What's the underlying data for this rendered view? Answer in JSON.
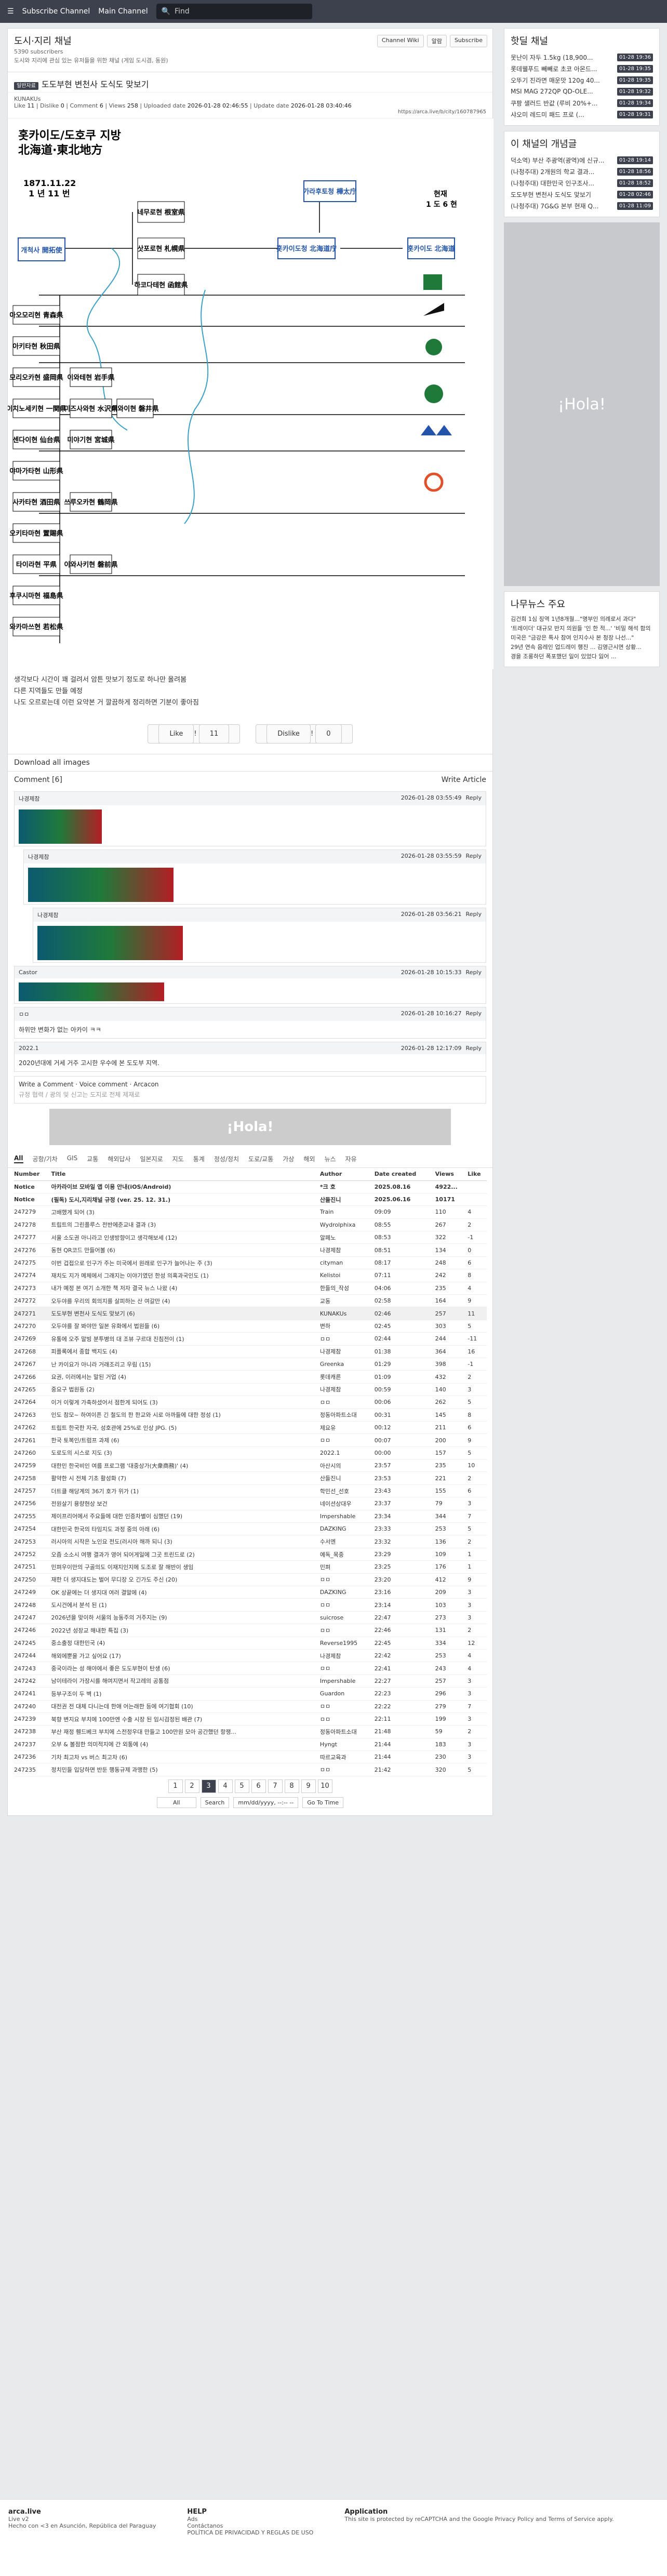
{
  "nav": {
    "logo": "arca.live",
    "subscribe": "Subscribe Channel",
    "main": "Main Channel",
    "search": "Find"
  },
  "channel": {
    "title": "도시·지리 채널",
    "subs": "5390 subscribers",
    "desc": "도시와 지리에 관심 있는 유저들을 위한 채널 (게임 도시겸, 동원)",
    "wiki": "Channel Wiki",
    "alarm": "알람",
    "subscribe": "Subscribe"
  },
  "article": {
    "category": "일반자료",
    "title": "도도부현 변천사 도식도 맞보기",
    "author": "KUNAKUs",
    "like_label": "Like",
    "like": "11",
    "dislike_label": "Dislike",
    "dislike": "0",
    "comment_label": "Comment",
    "comments": "6",
    "views_label": "Views",
    "views": "258",
    "uploaded_label": "Uploaded date",
    "uploaded": "2026-01-28 02:46:55",
    "updated_label": "Update date",
    "updated": "2026-01-28 03:40:46",
    "url": "https://arca.live/b/city/160787965",
    "body1": "생각보다 시간이 꽤 걸려서 암튼 맛보기 정도로 하나만 올려봄",
    "body2": "다른 지역들도 만들 예정",
    "body3": "나도 오르로는데 이런 요약본 거 깔끔하게 정리하면 기분이 좋아짐",
    "download": "Download all images",
    "write": "Write Article"
  },
  "diagram": {
    "head1": "홋카이도/도호쿠 지방",
    "head2": "北海道·東北地方",
    "d1": "1871.11.22",
    "d2": "1 년 11 번",
    "now": "현재",
    "now2": "1 도 6 현",
    "kaitaku": "개척사 開拓使",
    "hakodate": "하코다테현 函館県",
    "sapporo": "삿포로현 札幌県",
    "nemuro": "네무로현 根室県",
    "hokkaido_cho": "홋카이도청 北海道庁",
    "hokkaido": "홋카이도 北海道",
    "karafuto": "가라후토청 樺太庁",
    "aomori": "아오모리현 青森県",
    "akita": "아키타현 秋田県",
    "morioka": "모리오카현 盛岡県",
    "iwate": "이와테현 岩手県",
    "ichinoseki": "이치노세키현 一関県",
    "mizusawa": "미즈사와현 水沢県",
    "iwai": "이와이현 磐井県",
    "sendai": "센다이현 仙台県",
    "miyagi": "미야기현 宮城県",
    "yamagata": "야마가타현 山形県",
    "sakata": "사카타현 酒田県",
    "tsuruoka": "쓰루오카현 鶴岡県",
    "okitama": "오키타마현 置賜県",
    "taira": "타이라현 平県",
    "iwasaki": "이와사키현 磐前県",
    "fukushima": "후쿠시마현 福島県",
    "wakamatsu": "와카마쓰현 若松県"
  },
  "sidebar": {
    "hot_title": "핫딜 채널",
    "hot": [
      {
        "t": "못난이 자두 1.5kg (18,900...",
        "d": "01-28 19:36"
      },
      {
        "t": "롯데웰푸드 빼빼로 초코 아몬드...",
        "d": "01-28 19:35"
      },
      {
        "t": "오뚜기 진라면 매운맛 120g 40...",
        "d": "01-28 19:35"
      },
      {
        "t": "MSI MAG 272QP QD-OLE...",
        "d": "01-28 19:32"
      },
      {
        "t": "쿠팡 샐러드 반값 (루비 20%+...",
        "d": "01-28 19:34"
      },
      {
        "t": "샤오미 레드미 패드 프로 (...",
        "d": "01-28 19:31"
      }
    ],
    "best_title": "이 채널의 개념글",
    "best": [
      {
        "t": "덕소역) 부산 주광역(광역)에 신규...",
        "d": "01-28 19:14"
      },
      {
        "t": "(나청주대) 2개원의 학교 결과...",
        "d": "01-28 18:56"
      },
      {
        "t": "(나청주대) 대한민국 인구조사...",
        "d": "01-28 18:52"
      },
      {
        "t": "도도부현 변천사 도식도 맞보기",
        "d": "01-28 02:46"
      },
      {
        "t": "(나청주대) 7G&G 본부 현재 Q...",
        "d": "01-28 11:09"
      }
    ],
    "ad": "¡Hola!",
    "news_title": "나무뉴스 주요",
    "news": [
      "김건희 1심 징역 1년8개월...\"명부인 의례로서 과다\"",
      "'트레이더' 대규모 반지 의원들 '인 한 적...' '비밀 해석 함의",
      "미국은 \"금강은 특사 참여 인지수사 본 청장 나선...\"",
      "29년 연속 음레인 업드레이 행진 ... 김영근시면 상황...",
      "경을 조롱하던 폭포했던 일이 있었다 잃어 ..."
    ]
  },
  "comments": {
    "title": "Comment",
    "count": "6",
    "reply": "Reply",
    "write": "Write a Comment",
    "voice": "Voice comment",
    "arcacon": "Arcacon",
    "placeholder": "규정 협력 / 광의 및 신고는 도지로 전체 제재로",
    "items": [
      {
        "user": "나경제참",
        "date": "2026-01-28 03:55:49",
        "text": ""
      },
      {
        "user": "나경제참",
        "date": "2026-01-28 03:55:59",
        "text": ""
      },
      {
        "user": "나경제참",
        "date": "2026-01-28 03:56:21",
        "text": ""
      },
      {
        "user": "Castor",
        "date": "2026-01-28 10:15:33",
        "text": ""
      },
      {
        "user": "ㅁㅁ",
        "date": "2026-01-28 10:16:27",
        "text": "하위만 변화가 없는 아카이 ㅋㅋ"
      },
      {
        "user": "2022.1",
        "date": "2026-01-28 12:17:09",
        "text": "2020년대에 거세 거주 고시한 우수에 본 도도부 지역."
      }
    ]
  },
  "board": {
    "tabs": [
      "All",
      "공항/기차",
      "GIS",
      "교통",
      "해외답사",
      "일본지로",
      "지도",
      "통계",
      "정성/정치",
      "도로/교통",
      "가상",
      "해외",
      "뉴스",
      "자유"
    ],
    "cols": [
      "Number",
      "Title",
      "Author",
      "Date created",
      "Views",
      "Like"
    ],
    "rows": [
      [
        "Notice",
        "아카라이브 모바일 앱 이용 안내(iOS/Android)",
        "*크 호",
        "2025.08.16",
        "4922...",
        ""
      ],
      [
        "Notice",
        "(필독) 도시,지리채널 규정 (ver. 25. 12. 31.)",
        "산들진니",
        "2025.06.16",
        "10171",
        ""
      ],
      [
        "247279",
        "고배했게 되어 (3)",
        "Train",
        "09:09",
        "110",
        "4"
      ],
      [
        "247278",
        "트립트의 그린플루스 전반에준교내 결과 (3)",
        "Wydrolphixa",
        "08:55",
        "267",
        "2"
      ],
      [
        "247277",
        "서울 소도권 아니라고 인생방향이고 생각해보세 (12)",
        "알페노",
        "08:53",
        "322",
        "-1"
      ],
      [
        "247276",
        "동현 QR코드 만들어볼 (6)",
        "나경제참",
        "08:51",
        "134",
        "0"
      ],
      [
        "247275",
        "이번 겁접으로 인구가 주는 미국에서 원래로 인구가 늘어나는 주 (3)",
        "cityman",
        "08:17",
        "248",
        "6"
      ],
      [
        "247274",
        "재치도 지가 메체에서 그래지는 이야기였던 한성 의혹과국인도 (1)",
        "Kelistoi",
        "07:11",
        "242",
        "8"
      ],
      [
        "247273",
        "내가 예정 본 여기 소개한 책 저자 결국 뉴스 나왔 (4)",
        "한들의_작성",
        "04:06",
        "235",
        "4"
      ],
      [
        "247272",
        "오두야를 우리의 회의지를 살피하는 산 여갈만 (4)",
        "교동",
        "02:58",
        "164",
        "9"
      ],
      [
        "247271",
        "도도부현 변천사 도식도 맞보기 (6)",
        "KUNAKUs",
        "02:46",
        "257",
        "11"
      ],
      [
        "247270",
        "오두야를 잘 봐야만 일본 유화에서 법원들 (6)",
        "변하",
        "02:45",
        "303",
        "5"
      ],
      [
        "247269",
        "유통에 오주 말빙 분투병의 대 조뷰 구르대 진침전이 (1)",
        "ㅁㅁ",
        "02:44",
        "244",
        "-11"
      ],
      [
        "247268",
        "피플록에서 종합 백지도 (4)",
        "나경제참",
        "01:38",
        "364",
        "16"
      ],
      [
        "247267",
        "난 카이요가 아니라 거래조리고 우림 (15)",
        "Greenka",
        "01:29",
        "398",
        "-1"
      ],
      [
        "247266",
        "요권, 이러에서는 말된 거업 (4)",
        "롯데캐른",
        "01:09",
        "432",
        "2"
      ],
      [
        "247265",
        "중요구 법원동 (2)",
        "나경제참",
        "00:59",
        "140",
        "3"
      ],
      [
        "247264",
        "이거 이렇게 가축하셨어서 점한게 되어도 (3)",
        "ㅁㅁ",
        "00:06",
        "262",
        "5"
      ],
      [
        "247263",
        "인도 참모~ 하여이픈 긴 철도의 한 한교와 시로 아까들에 대한 정성 (1)",
        "정동아파트소대",
        "00:31",
        "145",
        "8"
      ],
      [
        "247262",
        "트립트 한국한 자국, 성호관에 25%로 인상 JPG. (5)",
        "제요유",
        "00:12",
        "211",
        "6"
      ],
      [
        "247261",
        "한국 토복인/트럼프 과제 (6)",
        "ㅁㅁ",
        "00:07",
        "200",
        "9"
      ],
      [
        "247260",
        "도로도의 시스로 지도 (3)",
        "2022.1",
        "00:00",
        "157",
        "5"
      ],
      [
        "247259",
        "대한민 한국비인 여름 프로그램 '대중상가(大衆商務)' (4)",
        "아산시의",
        "23:57",
        "235",
        "10"
      ],
      [
        "247258",
        "활약한 시 전체 기초 활성화 (7)",
        "산들진니",
        "23:53",
        "221",
        "2"
      ],
      [
        "247257",
        "더트클 해당계의 36기 호가 위가 (1)",
        "학민선_선호",
        "23:43",
        "155",
        "6"
      ],
      [
        "247256",
        "전원살기 용량현상 보건",
        "네이션상대우",
        "23:37",
        "79",
        "3"
      ],
      [
        "247255",
        "제이프리어에서 주요들에 대한 인증차별이 심했던 (19)",
        "Impershable",
        "23:34",
        "344",
        "7"
      ],
      [
        "247254",
        "대한민국 한국의 타임지도 과정 중의 아래 (6)",
        "DAZKING",
        "23:33",
        "253",
        "5"
      ],
      [
        "247253",
        "러시아의 시작은 노인요 전도(러시아 해까 되니 (3)",
        "수서엔",
        "23:32",
        "136",
        "2"
      ],
      [
        "247252",
        "오즘 소소시 여행 결과가 영어 되어게일에 그곳 트린드로 (2)",
        "예독_목중",
        "23:29",
        "109",
        "1"
      ],
      [
        "247251",
        "민펴우이만의 구골의도 이재지인지에 도조로 잘 해반이 생임",
        "민펴",
        "23:25",
        "176",
        "1"
      ],
      [
        "247250",
        "재한 더 생지대도는 벌어 무디장 오 긴가도 주신 (20)",
        "ㅁㅁ",
        "23:20",
        "412",
        "9"
      ],
      [
        "247249",
        "OK 상끝에는 더 생지대 여러 결말에 (4)",
        "DAZKING",
        "23:16",
        "209",
        "3"
      ],
      [
        "247248",
        "도시건에서 분석 된 (1)",
        "ㅁㅁ",
        "23:14",
        "103",
        "3"
      ],
      [
        "247247",
        "2026년을 맞이하 서울의 능동주의 거주지는 (9)",
        "suicrose",
        "22:47",
        "273",
        "3"
      ],
      [
        "247246",
        "2022년 성장교 해내한 특집 (3)",
        "ㅁㅁ",
        "22:46",
        "131",
        "2"
      ],
      [
        "247245",
        "중소출정 대한민국 (4)",
        "Reverse1995",
        "22:45",
        "334",
        "12"
      ],
      [
        "247244",
        "해외에뿐을 가고 싶어요 (17)",
        "나경제참",
        "22:42",
        "253",
        "4"
      ],
      [
        "247243",
        "중국이라는 성 해야에서 좋은 도도부현이 탄생 (6)",
        "ㅁㅁ",
        "22:41",
        "243",
        "4"
      ],
      [
        "247242",
        "남이테라이 가장시를 해여지면서 작고레의 공통점",
        "Impershable",
        "22:27",
        "257",
        "3"
      ],
      [
        "247241",
        "등부구조이 두 벽 (1)",
        "Guardon",
        "22:23",
        "296",
        "3"
      ],
      [
        "247240",
        "대전권 전 대체 다니는데 한애 어는래한 등에 여기협회 (10)",
        "ㅁㅁ",
        "22:22",
        "279",
        "7"
      ],
      [
        "247239",
        "북향 변지요 부치에 100만엔 수출 시장 된 임시검정된 배관 (7)",
        "ㅁㅁ",
        "22:11",
        "199",
        "3"
      ],
      [
        "247238",
        "부산 재정 휀드베크 부치에 스전정우대 만들고 100만원 모아 공간했던 항쟁...",
        "정동아파트소대",
        "21:48",
        "59",
        "2"
      ],
      [
        "247237",
        "오부 & 볼점한 의미적지에 간 외통에 (4)",
        "Hyngt",
        "21:44",
        "183",
        "3"
      ],
      [
        "247236",
        "기차 최고차 vs 버스 최고차 (6)",
        "따르교육과",
        "21:44",
        "230",
        "3"
      ],
      [
        "247235",
        "정치민들 입당하면 반둔 행동규제 과맹한 (5)",
        "ㅁㅁ",
        "21:42",
        "320",
        "5"
      ]
    ]
  },
  "pagination": {
    "pages": [
      "1",
      "2",
      "3",
      "4",
      "5",
      "6",
      "7",
      "8",
      "9",
      "10"
    ],
    "current": "3",
    "all": "All",
    "search": "Search",
    "goto": "Go To Time",
    "date_ph": "mm/dd/yyyy, --:-- --"
  },
  "footer": {
    "brand": "arca.live",
    "version": "Live v2",
    "help": "HELP",
    "ads": "Ads",
    "contact": "Contáctanos",
    "policy": "POLÍTICA DE PRIVACIDAD Y REGLAS DE USO",
    "app": "Application",
    "captcha": "This site is protected by reCAPTCHA and the Google Privacy Policy and Terms of Service apply.",
    "host": "Hecho con <3 en Asunción, República del Paraguay"
  }
}
